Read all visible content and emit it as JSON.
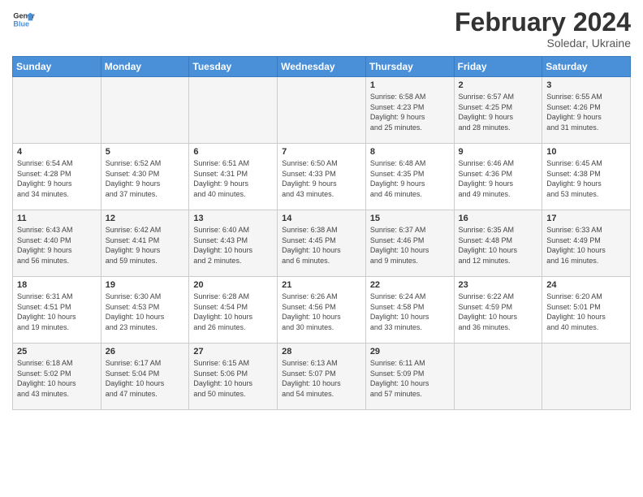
{
  "header": {
    "logo_line1": "General",
    "logo_line2": "Blue",
    "month": "February 2024",
    "location": "Soledar, Ukraine"
  },
  "weekdays": [
    "Sunday",
    "Monday",
    "Tuesday",
    "Wednesday",
    "Thursday",
    "Friday",
    "Saturday"
  ],
  "weeks": [
    [
      {
        "day": "",
        "info": ""
      },
      {
        "day": "",
        "info": ""
      },
      {
        "day": "",
        "info": ""
      },
      {
        "day": "",
        "info": ""
      },
      {
        "day": "1",
        "info": "Sunrise: 6:58 AM\nSunset: 4:23 PM\nDaylight: 9 hours\nand 25 minutes."
      },
      {
        "day": "2",
        "info": "Sunrise: 6:57 AM\nSunset: 4:25 PM\nDaylight: 9 hours\nand 28 minutes."
      },
      {
        "day": "3",
        "info": "Sunrise: 6:55 AM\nSunset: 4:26 PM\nDaylight: 9 hours\nand 31 minutes."
      }
    ],
    [
      {
        "day": "4",
        "info": "Sunrise: 6:54 AM\nSunset: 4:28 PM\nDaylight: 9 hours\nand 34 minutes."
      },
      {
        "day": "5",
        "info": "Sunrise: 6:52 AM\nSunset: 4:30 PM\nDaylight: 9 hours\nand 37 minutes."
      },
      {
        "day": "6",
        "info": "Sunrise: 6:51 AM\nSunset: 4:31 PM\nDaylight: 9 hours\nand 40 minutes."
      },
      {
        "day": "7",
        "info": "Sunrise: 6:50 AM\nSunset: 4:33 PM\nDaylight: 9 hours\nand 43 minutes."
      },
      {
        "day": "8",
        "info": "Sunrise: 6:48 AM\nSunset: 4:35 PM\nDaylight: 9 hours\nand 46 minutes."
      },
      {
        "day": "9",
        "info": "Sunrise: 6:46 AM\nSunset: 4:36 PM\nDaylight: 9 hours\nand 49 minutes."
      },
      {
        "day": "10",
        "info": "Sunrise: 6:45 AM\nSunset: 4:38 PM\nDaylight: 9 hours\nand 53 minutes."
      }
    ],
    [
      {
        "day": "11",
        "info": "Sunrise: 6:43 AM\nSunset: 4:40 PM\nDaylight: 9 hours\nand 56 minutes."
      },
      {
        "day": "12",
        "info": "Sunrise: 6:42 AM\nSunset: 4:41 PM\nDaylight: 9 hours\nand 59 minutes."
      },
      {
        "day": "13",
        "info": "Sunrise: 6:40 AM\nSunset: 4:43 PM\nDaylight: 10 hours\nand 2 minutes."
      },
      {
        "day": "14",
        "info": "Sunrise: 6:38 AM\nSunset: 4:45 PM\nDaylight: 10 hours\nand 6 minutes."
      },
      {
        "day": "15",
        "info": "Sunrise: 6:37 AM\nSunset: 4:46 PM\nDaylight: 10 hours\nand 9 minutes."
      },
      {
        "day": "16",
        "info": "Sunrise: 6:35 AM\nSunset: 4:48 PM\nDaylight: 10 hours\nand 12 minutes."
      },
      {
        "day": "17",
        "info": "Sunrise: 6:33 AM\nSunset: 4:49 PM\nDaylight: 10 hours\nand 16 minutes."
      }
    ],
    [
      {
        "day": "18",
        "info": "Sunrise: 6:31 AM\nSunset: 4:51 PM\nDaylight: 10 hours\nand 19 minutes."
      },
      {
        "day": "19",
        "info": "Sunrise: 6:30 AM\nSunset: 4:53 PM\nDaylight: 10 hours\nand 23 minutes."
      },
      {
        "day": "20",
        "info": "Sunrise: 6:28 AM\nSunset: 4:54 PM\nDaylight: 10 hours\nand 26 minutes."
      },
      {
        "day": "21",
        "info": "Sunrise: 6:26 AM\nSunset: 4:56 PM\nDaylight: 10 hours\nand 30 minutes."
      },
      {
        "day": "22",
        "info": "Sunrise: 6:24 AM\nSunset: 4:58 PM\nDaylight: 10 hours\nand 33 minutes."
      },
      {
        "day": "23",
        "info": "Sunrise: 6:22 AM\nSunset: 4:59 PM\nDaylight: 10 hours\nand 36 minutes."
      },
      {
        "day": "24",
        "info": "Sunrise: 6:20 AM\nSunset: 5:01 PM\nDaylight: 10 hours\nand 40 minutes."
      }
    ],
    [
      {
        "day": "25",
        "info": "Sunrise: 6:18 AM\nSunset: 5:02 PM\nDaylight: 10 hours\nand 43 minutes."
      },
      {
        "day": "26",
        "info": "Sunrise: 6:17 AM\nSunset: 5:04 PM\nDaylight: 10 hours\nand 47 minutes."
      },
      {
        "day": "27",
        "info": "Sunrise: 6:15 AM\nSunset: 5:06 PM\nDaylight: 10 hours\nand 50 minutes."
      },
      {
        "day": "28",
        "info": "Sunrise: 6:13 AM\nSunset: 5:07 PM\nDaylight: 10 hours\nand 54 minutes."
      },
      {
        "day": "29",
        "info": "Sunrise: 6:11 AM\nSunset: 5:09 PM\nDaylight: 10 hours\nand 57 minutes."
      },
      {
        "day": "",
        "info": ""
      },
      {
        "day": "",
        "info": ""
      }
    ]
  ]
}
